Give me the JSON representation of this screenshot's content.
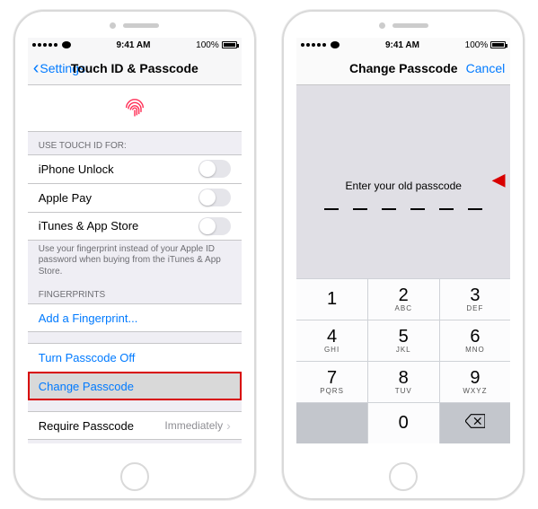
{
  "statusbar": {
    "time": "9:41 AM",
    "battery_pct": "100%"
  },
  "left": {
    "nav": {
      "back_label": "Settings",
      "title": "Touch ID & Passcode"
    },
    "sections": {
      "use_touch_id_header": "USE TOUCH ID FOR:",
      "rows": {
        "iphone_unlock": "iPhone Unlock",
        "apple_pay": "Apple Pay",
        "itunes": "iTunes & App Store"
      },
      "touch_id_footer": "Use your fingerprint instead of your Apple ID password when buying from the iTunes & App Store.",
      "fingerprints_header": "FINGERPRINTS",
      "add_fingerprint": "Add a Fingerprint...",
      "turn_passcode_off": "Turn Passcode Off",
      "change_passcode": "Change Passcode",
      "require_passcode_label": "Require Passcode",
      "require_passcode_value": "Immediately"
    }
  },
  "right": {
    "nav": {
      "title": "Change Passcode",
      "cancel": "Cancel"
    },
    "prompt": "Enter your old passcode",
    "keypad": [
      {
        "digit": "1",
        "letters": ""
      },
      {
        "digit": "2",
        "letters": "ABC"
      },
      {
        "digit": "3",
        "letters": "DEF"
      },
      {
        "digit": "4",
        "letters": "GHI"
      },
      {
        "digit": "5",
        "letters": "JKL"
      },
      {
        "digit": "6",
        "letters": "MNO"
      },
      {
        "digit": "7",
        "letters": "PQRS"
      },
      {
        "digit": "8",
        "letters": "TUV"
      },
      {
        "digit": "9",
        "letters": "WXYZ"
      },
      {
        "digit": "0",
        "letters": ""
      }
    ]
  }
}
